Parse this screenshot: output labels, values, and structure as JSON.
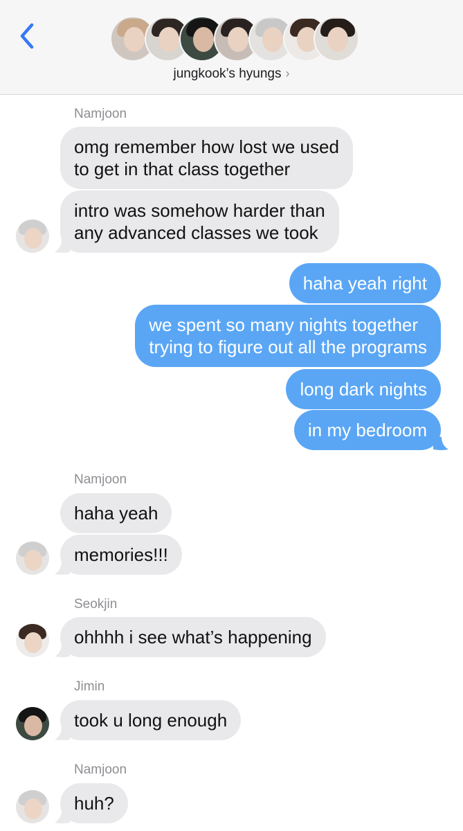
{
  "header": {
    "group_name": "jungkook’s hyungs",
    "chevron": "›",
    "back_icon": "chevron-left-icon",
    "accent": "#3478f6",
    "members": [
      "member-1",
      "member-2",
      "member-3",
      "member-4",
      "member-5",
      "member-6",
      "member-7"
    ]
  },
  "messages": [
    {
      "sender": "Namjoon",
      "text": [
        "omg remember how lost we used",
        "to get in that class together"
      ]
    },
    {
      "text": [
        "intro was somehow harder than",
        "any advanced classes we took"
      ]
    },
    {
      "text": [
        "haha yeah right"
      ]
    },
    {
      "text": [
        "we spent so many nights together",
        "trying to figure out all the programs"
      ]
    },
    {
      "text": [
        "long dark nights"
      ]
    },
    {
      "text": [
        "in my bedroom"
      ]
    },
    {
      "sender": "Namjoon",
      "text": [
        "haha yeah"
      ]
    },
    {
      "text": [
        "memories!!!"
      ]
    },
    {
      "sender": "Seokjin",
      "text": [
        "ohhhh i see what’s happening"
      ]
    },
    {
      "sender": "Jimin",
      "text": [
        "took u long enough"
      ]
    },
    {
      "sender": "Namjoon",
      "text": [
        "huh?"
      ]
    }
  ],
  "colors": {
    "incoming_bubble": "#e9e9eb",
    "outgoing_bubble": "#5aa6f5",
    "sender_label": "#8e8e93"
  }
}
